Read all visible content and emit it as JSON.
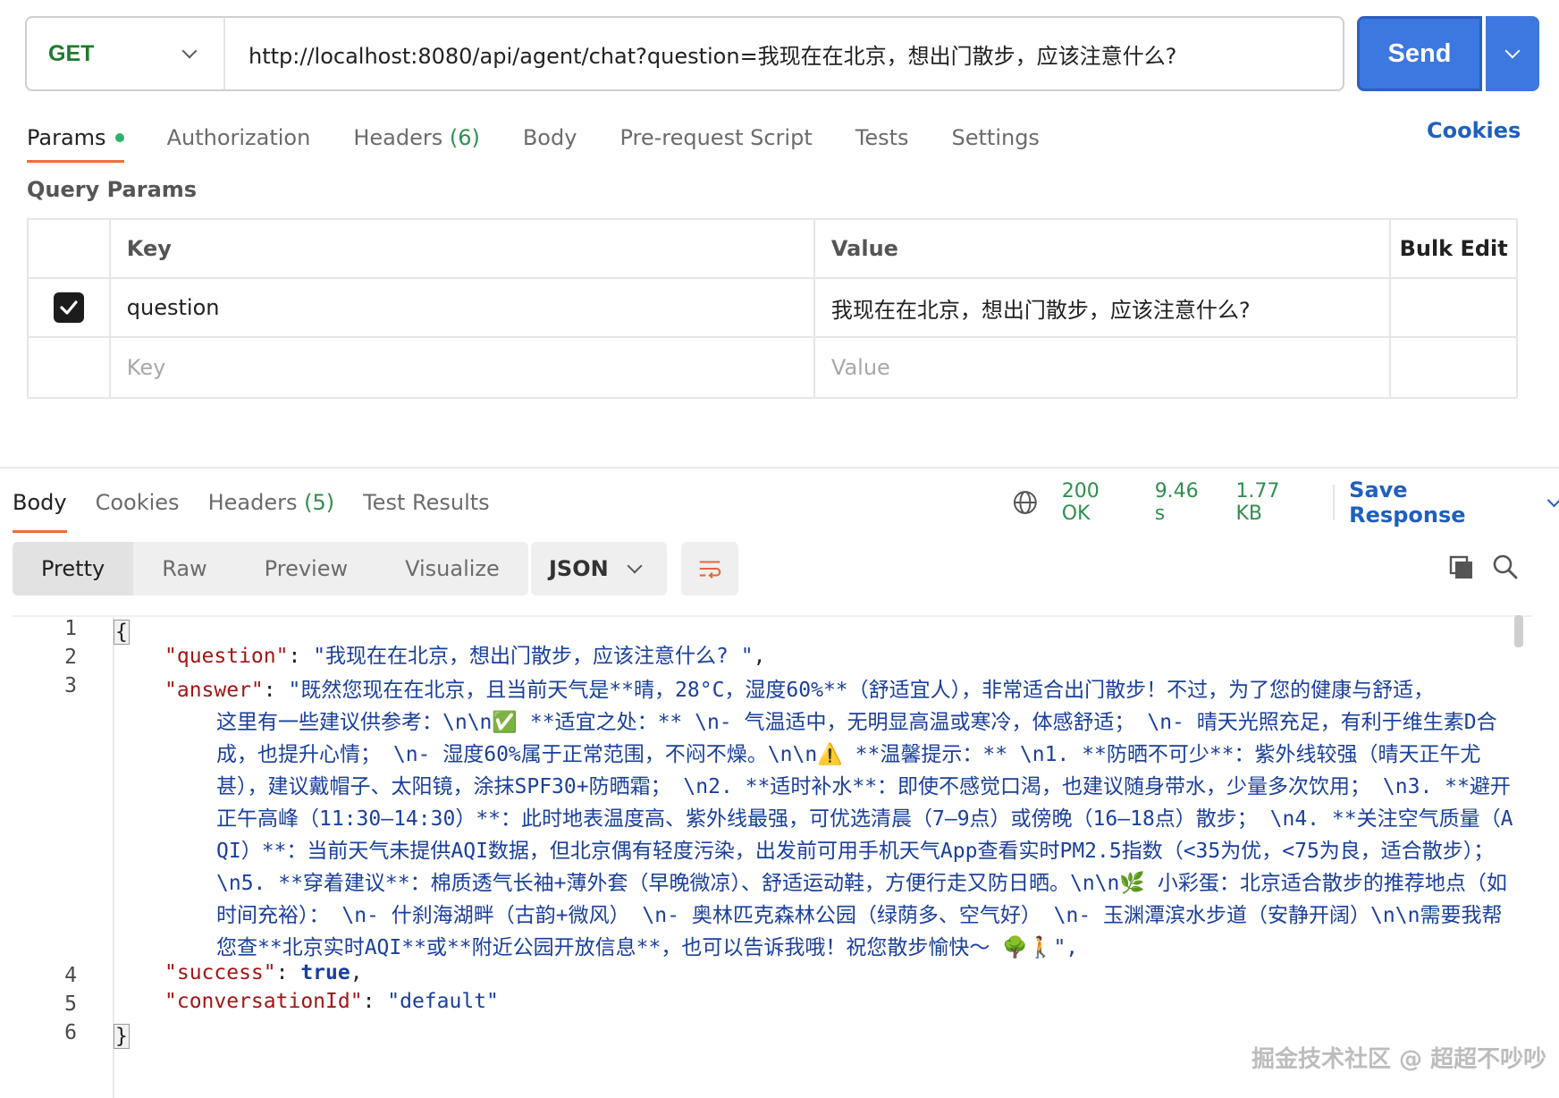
{
  "request": {
    "method": "GET",
    "url": "http://localhost:8080/api/agent/chat?question=我现在在北京，想出门散步，应该注意什么?",
    "send_label": "Send"
  },
  "request_tabs": {
    "params": "Params",
    "authorization": "Authorization",
    "headers": "Headers",
    "headers_count": "(6)",
    "body": "Body",
    "prerequest": "Pre-request Script",
    "tests": "Tests",
    "settings": "Settings",
    "cookies": "Cookies"
  },
  "query_params": {
    "title": "Query Params",
    "header_key": "Key",
    "header_value": "Value",
    "bulk_edit": "Bulk Edit",
    "rows": [
      {
        "checked": true,
        "key": "question",
        "value": "我现在在北京，想出门散步，应该注意什么?"
      }
    ],
    "placeholder_key": "Key",
    "placeholder_value": "Value"
  },
  "response_tabs": {
    "body": "Body",
    "cookies": "Cookies",
    "headers": "Headers",
    "headers_count": "(5)",
    "test_results": "Test Results"
  },
  "response_status": {
    "code": "200 OK",
    "time": "9.46 s",
    "size": "1.77 KB",
    "save_label": "Save Response"
  },
  "view_modes": {
    "pretty": "Pretty",
    "raw": "Raw",
    "preview": "Preview",
    "visualize": "Visualize",
    "format": "JSON"
  },
  "code": {
    "line_numbers": [
      "1",
      "2",
      "3",
      "4",
      "5",
      "6"
    ],
    "open_brace": "{",
    "close_brace": "}",
    "q_key": "\"question\"",
    "q_value": "\"我现在在北京，想出门散步，应该注意什么? \"",
    "a_key": "\"answer\"",
    "a_first": "\"既然您现在在北京，且当前天气是**晴，28°C，湿度60%**（舒适宜人），非常适合出门散步！不过，为了您的健康与舒适，",
    "a_rest": "这里有一些建议供参考：\\n\\n✅ **适宜之处：**  \\n- 气温适中，无明显高温或寒冷，体感舒适；  \\n- 晴天光照充足，有利于维生素D合成，也提升心情；  \\n- 湿度60%属于正常范围，不闷不燥。\\n\\n⚠️ **温馨提示：**  \\n1. **防晒不可少**：紫外线较强（晴天正午尤甚），建议戴帽子、太阳镜，涂抹SPF30+防晒霜；  \\n2. **适时补水**：即使不感觉口渴，也建议随身带水，少量多次饮用；  \\n3. **避开正午高峰（11:30–14:30）**：此时地表温度高、紫外线最强，可优选清晨（7–9点）或傍晚（16–18点）散步；  \\n4. **关注空气质量（AQI）**：当前天气未提供AQI数据，但北京偶有轻度污染，出发前可用手机天气App查看实时PM2.5指数（<35为优，<75为良，适合散步）；  \\n5. **穿着建议**：棉质透气长袖+薄外套（早晚微凉）、舒适运动鞋，方便行走又防日晒。\\n\\n🌿 小彩蛋：北京适合散步的推荐地点（如时间充裕）：  \\n- 什刹海湖畔（古韵+微风）  \\n- 奥林匹克森林公园（绿荫多、空气好）  \\n- 玉渊潭滨水步道（安静开阔）\\n\\n需要我帮您查**北京实时AQI**或**附近公园开放信息**，也可以告诉我哦！祝您散步愉快～ 🌳🚶\",",
    "s_key": "\"success\"",
    "s_value": "true",
    "c_key": "\"conversationId\"",
    "c_value": "\"default\""
  },
  "watermark": "掘金技术社区 @ 超超不吵吵"
}
